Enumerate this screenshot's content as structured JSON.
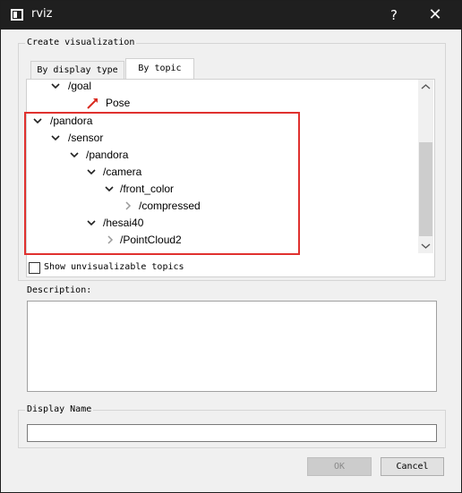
{
  "window": {
    "title": "rviz",
    "help_label": "?",
    "close_label": "✕"
  },
  "create_group": {
    "title": "Create visualization",
    "tabs": [
      {
        "label": "By display type",
        "selected": false
      },
      {
        "label": "By topic",
        "selected": true
      }
    ]
  },
  "tree": {
    "items": [
      {
        "label": "/goal",
        "expanded": true
      },
      {
        "label": "Pose",
        "icon": "pose-arrow-icon"
      },
      {
        "label": "/pandora",
        "expanded": true
      },
      {
        "label": "/sensor",
        "expanded": true
      },
      {
        "label": "/pandora",
        "expanded": true
      },
      {
        "label": "/camera",
        "expanded": true
      },
      {
        "label": "/front_color",
        "expanded": true
      },
      {
        "label": "/compressed",
        "expanded": false
      },
      {
        "label": "/hesai40",
        "expanded": true
      },
      {
        "label": "/PointCloud2",
        "expanded": false
      }
    ]
  },
  "show_unvisualizable": {
    "label": "Show unvisualizable topics",
    "checked": false
  },
  "description": {
    "label": "Description:",
    "text": ""
  },
  "display_name": {
    "label": "Display Name",
    "value": ""
  },
  "buttons": {
    "ok": "OK",
    "cancel": "Cancel"
  },
  "colors": {
    "titlebar": "#1f1f1f",
    "highlight": "#e0312f",
    "pose_arrow": "#d92b20",
    "window_bg": "#f0f0f0"
  }
}
